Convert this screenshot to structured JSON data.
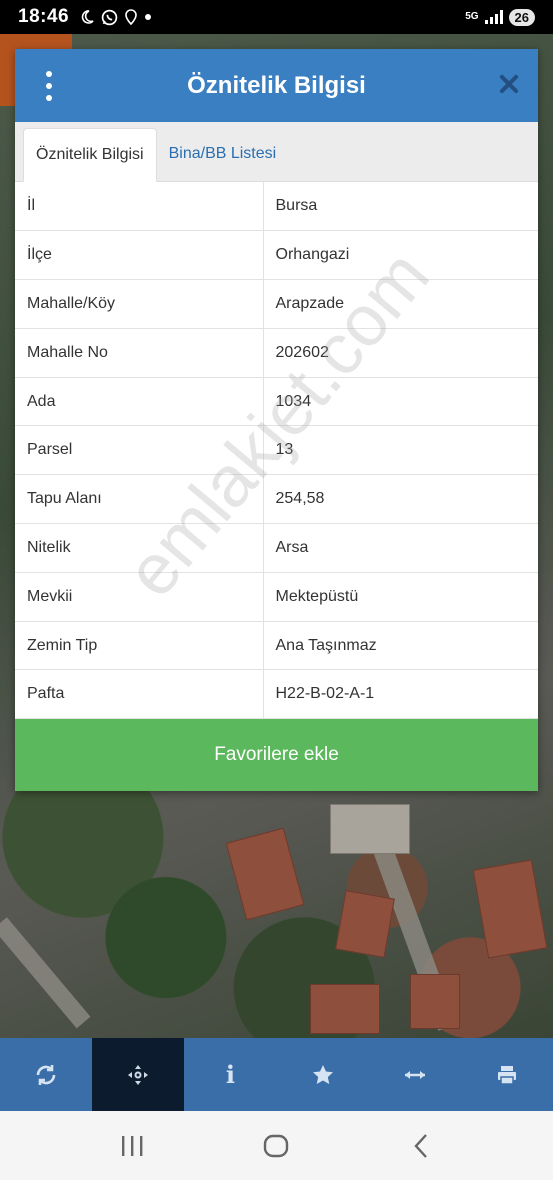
{
  "status_bar": {
    "time": "18:46",
    "network": "5G",
    "battery": "26",
    "icons": [
      "moon-icon",
      "whatsapp-icon",
      "location-icon",
      "dot-icon"
    ]
  },
  "dialog": {
    "title": "Öznitelik Bilgisi",
    "tabs": [
      {
        "label": "Öznitelik Bilgisi",
        "active": true
      },
      {
        "label": "Bina/BB Listesi",
        "active": false
      }
    ],
    "rows": [
      {
        "key": "İl",
        "value": "Bursa"
      },
      {
        "key": "İlçe",
        "value": "Orhangazi"
      },
      {
        "key": "Mahalle/Köy",
        "value": "Arapzade"
      },
      {
        "key": "Mahalle No",
        "value": "202602"
      },
      {
        "key": "Ada",
        "value": "1034"
      },
      {
        "key": "Parsel",
        "value": "13"
      },
      {
        "key": "Tapu Alanı",
        "value": "254,58"
      },
      {
        "key": "Nitelik",
        "value": "Arsa"
      },
      {
        "key": "Mevkii",
        "value": "Mektepüstü"
      },
      {
        "key": "Zemin Tip",
        "value": "Ana Taşınmaz"
      },
      {
        "key": "Pafta",
        "value": "H22-B-02-A-1"
      }
    ],
    "favorite_button": "Favorilere ekle"
  },
  "watermark": "emlakjet.com",
  "toolbar": {
    "items": [
      "refresh-icon",
      "move-icon",
      "info-icon",
      "star-icon",
      "measure-icon",
      "print-icon"
    ],
    "active_index": 1,
    "info_glyph": "i"
  },
  "colors": {
    "header": "#3a7fc1",
    "favorite_button": "#5cb85c",
    "toolbar": "#3a6ea8",
    "toolbar_active": "#0d1b2e"
  }
}
